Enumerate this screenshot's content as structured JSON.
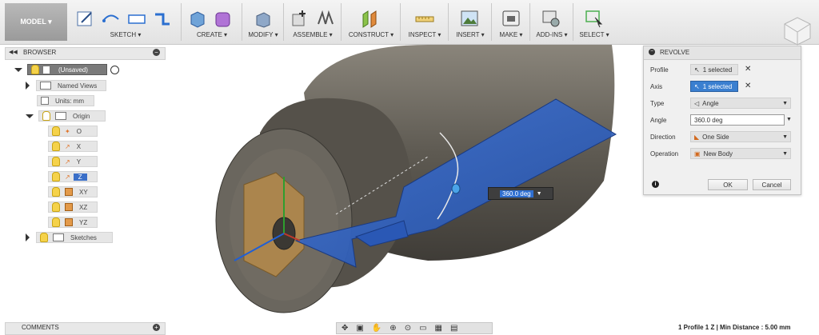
{
  "toolbar": {
    "model_label": "MODEL ▾",
    "groups": [
      {
        "label": "SKETCH ▾"
      },
      {
        "label": "CREATE ▾"
      },
      {
        "label": "MODIFY ▾"
      },
      {
        "label": "ASSEMBLE ▾"
      },
      {
        "label": "CONSTRUCT ▾"
      },
      {
        "label": "INSPECT ▾"
      },
      {
        "label": "INSERT ▾"
      },
      {
        "label": "MAKE ▾"
      },
      {
        "label": "ADD-INS ▾"
      },
      {
        "label": "SELECT ▾"
      }
    ]
  },
  "browser": {
    "title": "BROWSER",
    "items": [
      {
        "label": "(Unsaved)"
      },
      {
        "label": "Named Views"
      },
      {
        "label": "Units: mm"
      },
      {
        "label": "Origin"
      },
      {
        "label": "O"
      },
      {
        "label": "X"
      },
      {
        "label": "Y"
      },
      {
        "label": "Z"
      },
      {
        "label": "XY"
      },
      {
        "label": "XZ"
      },
      {
        "label": "YZ"
      },
      {
        "label": "Sketches"
      }
    ]
  },
  "comments": {
    "title": "COMMENTS"
  },
  "revolve": {
    "title": "REVOLVE",
    "profile_label": "Profile",
    "profile_value": "1 selected",
    "axis_label": "Axis",
    "axis_value": "1 selected",
    "type_label": "Type",
    "type_value": "Angle",
    "angle_label": "Angle",
    "angle_value": "360.0 deg",
    "direction_label": "Direction",
    "direction_value": "One Side",
    "operation_label": "Operation",
    "operation_value": "New Body",
    "ok_label": "OK",
    "cancel_label": "Cancel"
  },
  "canvas": {
    "angle_input": "360.0 deg"
  },
  "status": {
    "text": "1 Profile 1 Z | Min Distance : 5.00 mm"
  },
  "colors": {
    "accent": "#3b6fd0",
    "profile": "#2d5fc2",
    "body": "#6f6a60"
  }
}
